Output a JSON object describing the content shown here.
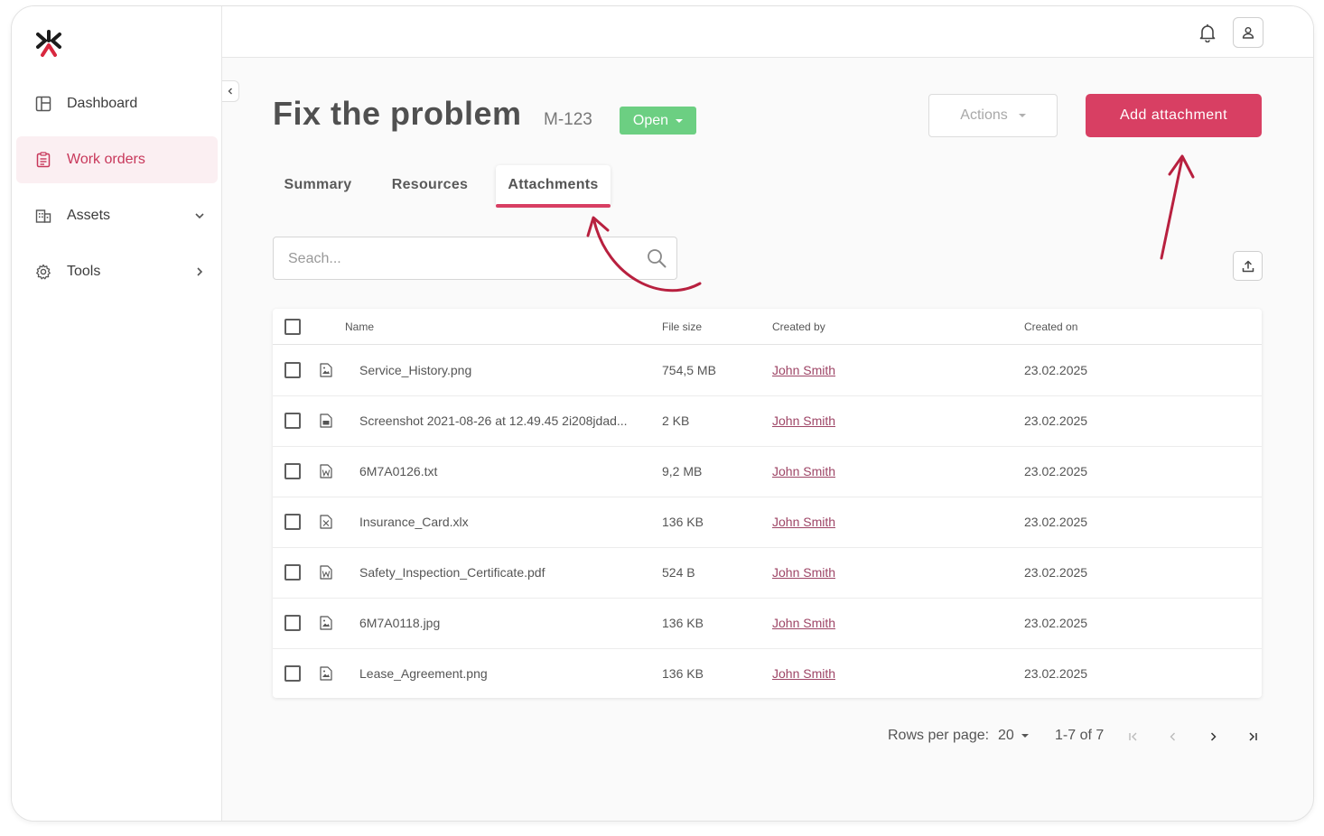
{
  "sidebar": {
    "items": [
      {
        "label": "Dashboard",
        "icon": "dashboard-icon"
      },
      {
        "label": "Work orders",
        "icon": "clipboard-icon",
        "active": true
      },
      {
        "label": "Assets",
        "icon": "building-icon",
        "chevron": "chevron-down-icon"
      },
      {
        "label": "Tools",
        "icon": "gear-icon",
        "chevron": "chevron-right-icon"
      }
    ]
  },
  "header": {
    "title": "Fix the problem",
    "code": "M-123",
    "status": "Open",
    "actions_label": "Actions",
    "add_label": "Add attachment"
  },
  "tabs": [
    {
      "label": "Summary"
    },
    {
      "label": "Resources"
    },
    {
      "label": "Attachments",
      "active": true
    }
  ],
  "search": {
    "placeholder": "Seach..."
  },
  "table": {
    "columns": {
      "name": "Name",
      "size": "File size",
      "created_by": "Created by",
      "created_on": "Created on"
    },
    "rows": [
      {
        "icon": "image-file-icon",
        "name": "Service_History.png",
        "size": "754,5 MB",
        "created_by": "John Smith",
        "created_on": "23.02.2025"
      },
      {
        "icon": "document-file-icon",
        "name": "Screenshot 2021-08-26 at 12.49.45 2i208jdad...",
        "size": "2 KB",
        "created_by": "John Smith",
        "created_on": "23.02.2025"
      },
      {
        "icon": "word-file-icon",
        "name": "6M7A0126.txt",
        "size": "9,2 MB",
        "created_by": "John Smith",
        "created_on": "23.02.2025"
      },
      {
        "icon": "excel-file-icon",
        "name": "Insurance_Card.xlx",
        "size": "136 KB",
        "created_by": "John Smith",
        "created_on": "23.02.2025"
      },
      {
        "icon": "word-file-icon",
        "name": "Safety_Inspection_Certificate.pdf",
        "size": "524 B",
        "created_by": "John Smith",
        "created_on": "23.02.2025"
      },
      {
        "icon": "image-file-icon",
        "name": "6M7A0118.jpg",
        "size": "136 KB",
        "created_by": "John Smith",
        "created_on": "23.02.2025"
      },
      {
        "icon": "image-file-icon",
        "name": "Lease_Agreement.png",
        "size": "136 KB",
        "created_by": "John Smith",
        "created_on": "23.02.2025"
      }
    ]
  },
  "pagination": {
    "rows_label": "Rows per page:",
    "rows_value": "20",
    "range": "1-7 of 7"
  },
  "colors": {
    "accent": "#d83f63",
    "status": "#6ccf82",
    "link": "#9e4566",
    "annotation": "#b8203f"
  }
}
